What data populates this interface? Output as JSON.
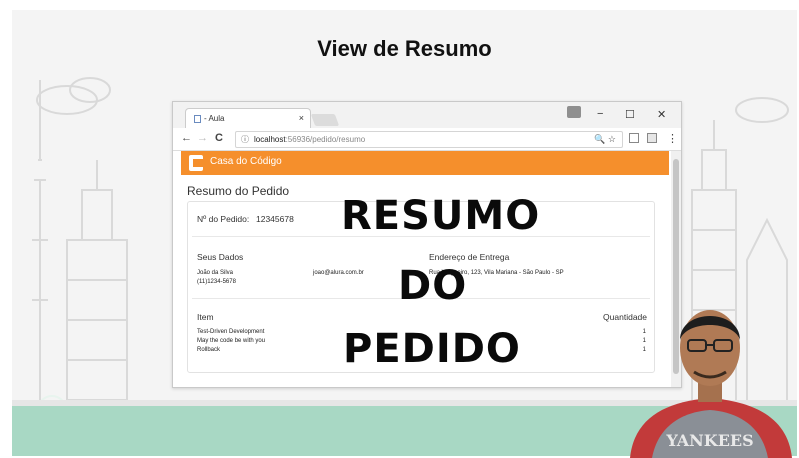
{
  "slide": {
    "title": "View de Resumo"
  },
  "browser": {
    "tab_label": "- Aula",
    "tab_close": "×",
    "win_minimize": "−",
    "win_maximize": "☐",
    "win_close": "✕",
    "back": "←",
    "forward": "→",
    "reload": "C",
    "url_info_icon": "ⓘ",
    "url_host": "localhost",
    "url_path": ":56936/pedido/resumo",
    "url_right": "🔍 ☆",
    "menu": "⋮"
  },
  "site": {
    "brand": "Casa do Código"
  },
  "page": {
    "title": "Resumo do Pedido",
    "order_label": "Nº do Pedido:",
    "order_number": "12345678",
    "customer": {
      "heading": "Seus Dados",
      "name": "João da Silva",
      "phone": "(11)1234-5678",
      "email": "joao@alura.com.br"
    },
    "delivery": {
      "heading": "Endereço de Entrega",
      "address": "Rua Vergueiro, 123, Vila Mariana - São Paulo - SP"
    },
    "items": {
      "heading": "Item",
      "qty_heading": "Quantidade",
      "rows": [
        {
          "name": "Test-Driven Development",
          "qty": "1"
        },
        {
          "name": "May the code be with you",
          "qty": "1"
        },
        {
          "name": "Rollback",
          "qty": "1"
        }
      ]
    }
  },
  "overlay": {
    "line1": "RESUMO",
    "line2": "DO",
    "line3": "PEDIDO"
  },
  "presenter": {
    "shirt_text": "YANKEES"
  },
  "colors": {
    "accent": "#f58f2c",
    "ground": "#a8d8c4",
    "shirt": "#c23a3a"
  }
}
